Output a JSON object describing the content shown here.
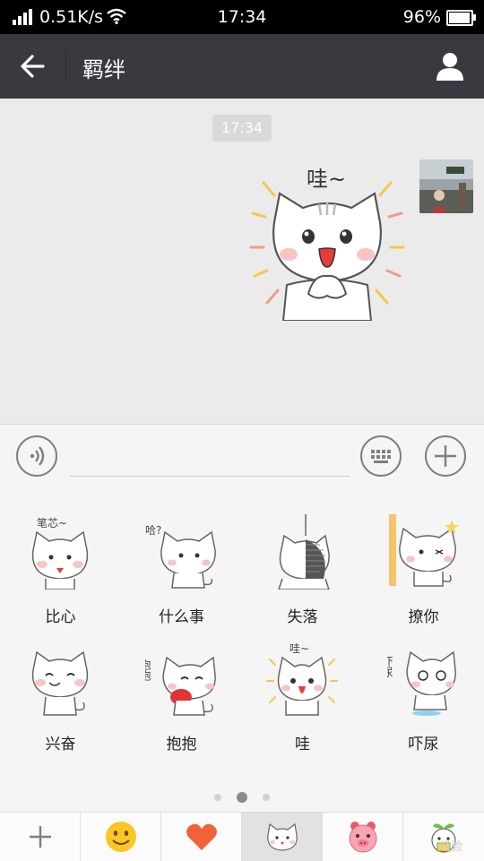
{
  "status_bar": {
    "network_speed": "0.51K/s",
    "time": "17:34",
    "battery_percent": "96%",
    "battery_level": 0.96
  },
  "header": {
    "title": "羁绊"
  },
  "chat": {
    "timestamp": "17:34",
    "message": {
      "type": "sticker",
      "sticker_text": "哇~"
    }
  },
  "emoji_panel": {
    "items": [
      {
        "label": "比心",
        "caption": "笔芯~"
      },
      {
        "label": "什么事",
        "caption": "哈?"
      },
      {
        "label": "失落",
        "caption": ""
      },
      {
        "label": "撩你",
        "caption": ""
      },
      {
        "label": "兴奋",
        "caption": ""
      },
      {
        "label": "抱抱",
        "caption": "抱抱"
      },
      {
        "label": "哇",
        "caption": "哇~"
      },
      {
        "label": "吓尿",
        "caption": "吓尿"
      }
    ],
    "page_count": 3,
    "current_page": 2
  },
  "tabs": [
    {
      "icon": "plus-icon"
    },
    {
      "icon": "smiley-icon"
    },
    {
      "icon": "heart-icon"
    },
    {
      "icon": "cat-sticker-icon",
      "selected": true
    },
    {
      "icon": "pig-sticker-icon"
    },
    {
      "icon": "sprout-sticker-icon"
    }
  ],
  "watermark": "经验"
}
